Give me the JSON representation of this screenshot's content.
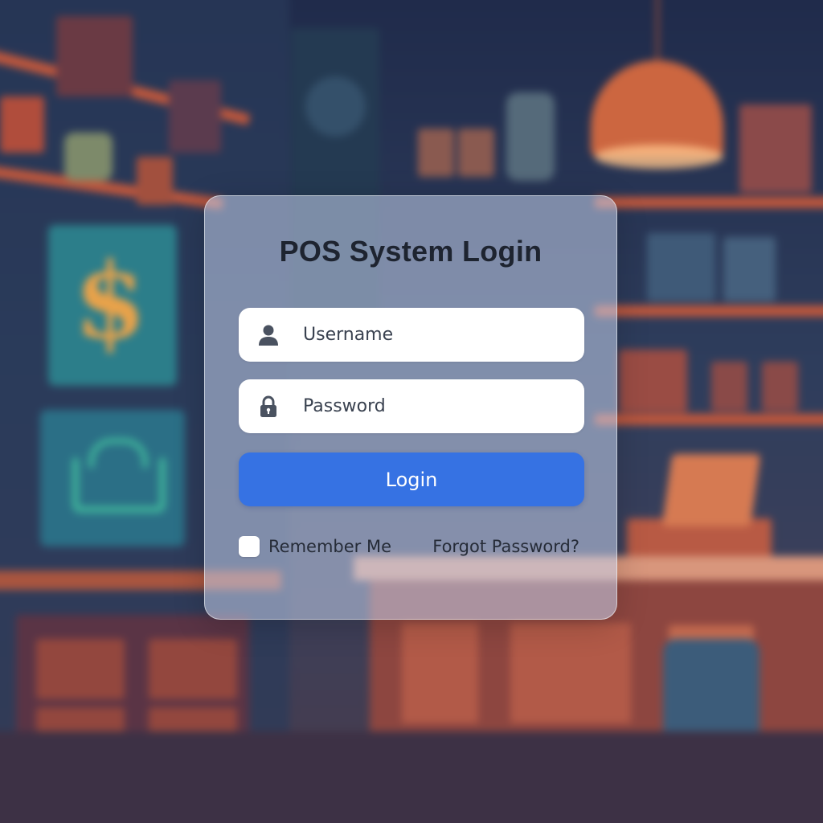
{
  "login": {
    "title": "POS System Login",
    "username_placeholder": "Username",
    "password_placeholder": "Password",
    "login_label": "Login",
    "remember_label": "Remember Me",
    "remember_checked": false,
    "forgot_label": "Forgot Password?"
  },
  "icons": {
    "username": "user-icon",
    "password": "lock-icon"
  },
  "colors": {
    "primary_button": "#3672e3",
    "card_background": "rgba(196,210,236,0.55)",
    "title_text": "#1e2430"
  },
  "background": {
    "sign_symbol": "$"
  }
}
